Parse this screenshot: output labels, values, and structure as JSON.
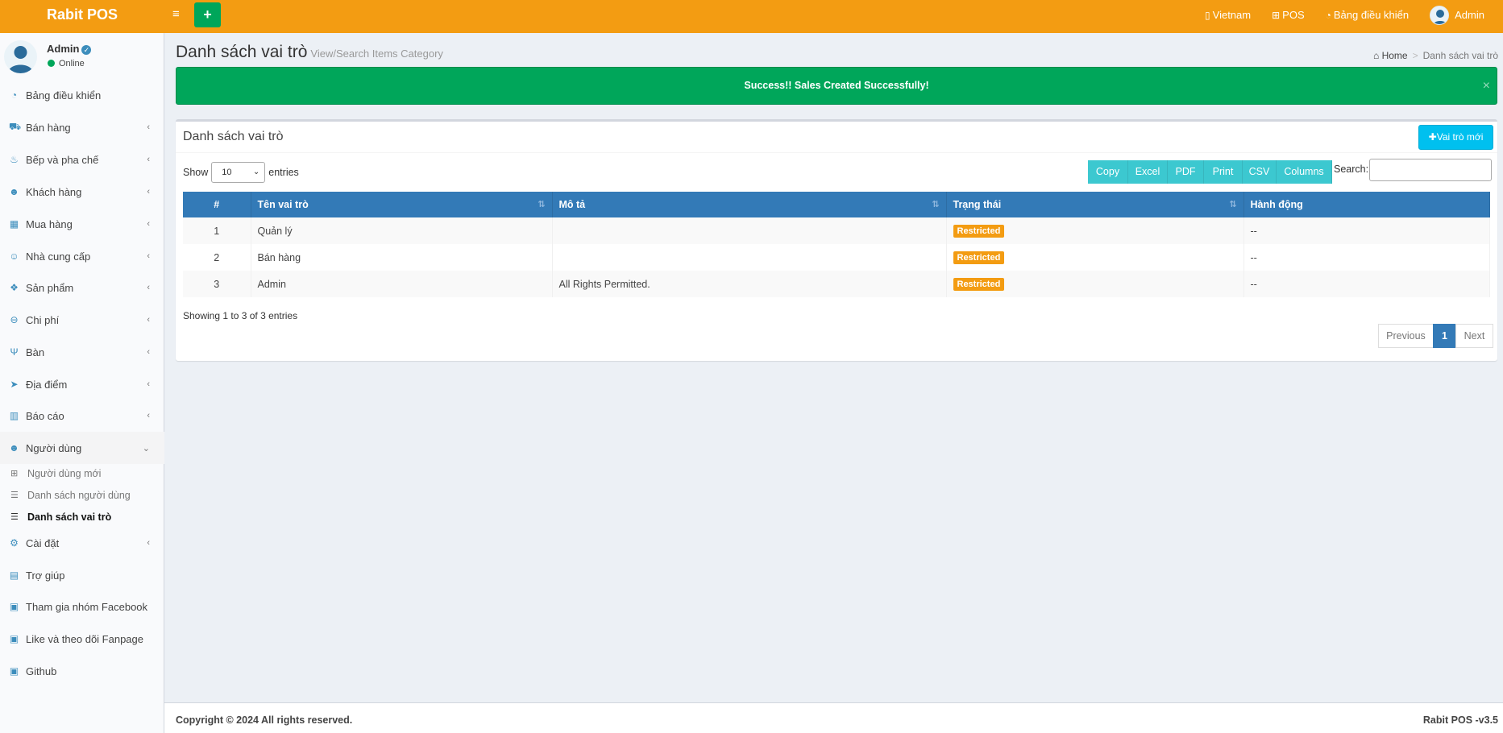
{
  "header": {
    "brand": "Rabit POS",
    "nav": {
      "language": "Vietnam",
      "pos": "POS",
      "dashboard": "Bảng điều khiển",
      "user": "Admin"
    },
    "accent_color": "#f39c12"
  },
  "sidebar": {
    "user": {
      "name": "Admin",
      "status": "Online"
    },
    "items": [
      {
        "label": "Bảng điều khiển",
        "icon": "dashboard-icon",
        "has_children": false
      },
      {
        "label": "Bán hàng",
        "icon": "cart-icon",
        "has_children": true
      },
      {
        "label": "Bếp và pha chế",
        "icon": "kitchen-icon",
        "has_children": true
      },
      {
        "label": "Khách hàng",
        "icon": "users-icon",
        "has_children": true
      },
      {
        "label": "Mua hàng",
        "icon": "grid-icon",
        "has_children": true
      },
      {
        "label": "Nhà cung cấp",
        "icon": "user-plus-icon",
        "has_children": true
      },
      {
        "label": "Sản phẩm",
        "icon": "cubes-icon",
        "has_children": true
      },
      {
        "label": "Chi phí",
        "icon": "minus-circle-icon",
        "has_children": true
      },
      {
        "label": "Bàn",
        "icon": "cutlery-icon",
        "has_children": true
      },
      {
        "label": "Địa điểm",
        "icon": "paper-plane-icon",
        "has_children": true
      },
      {
        "label": "Báo cáo",
        "icon": "bar-chart-icon",
        "has_children": true
      },
      {
        "label": "Người dùng",
        "icon": "users-icon",
        "has_children": true,
        "expanded": true
      }
    ],
    "submenu": [
      {
        "label": "Người dùng mới",
        "icon": "plus-square-icon"
      },
      {
        "label": "Danh sách người dùng",
        "icon": "list-icon"
      },
      {
        "label": "Danh sách vai trò",
        "icon": "list-icon",
        "current": true
      }
    ],
    "items_after": [
      {
        "label": "Cài đặt",
        "icon": "cogs-icon",
        "has_children": true
      },
      {
        "label": "Trợ giúp",
        "icon": "book-icon",
        "has_children": false
      },
      {
        "label": "Tham gia nhóm Facebook",
        "icon": "briefcase-icon",
        "has_children": false
      },
      {
        "label": "Like và theo dõi Fanpage",
        "icon": "briefcase-icon",
        "has_children": false
      },
      {
        "label": "Github",
        "icon": "briefcase-icon",
        "has_children": false
      }
    ]
  },
  "content": {
    "title": "Danh sách vai trò",
    "subtitle": "View/Search Items Category",
    "breadcrumb": {
      "home": "Home",
      "current": "Danh sách vai trò"
    },
    "alert": "Success!! Sales Created Successfully!",
    "alert_close": "×"
  },
  "box": {
    "title": "Danh sách vai trò",
    "new_button": "Vai trò mới",
    "show_label": "Show",
    "entries_label": "entries",
    "page_length": "10",
    "export_buttons": [
      "Copy",
      "Excel",
      "PDF",
      "Print",
      "CSV",
      "Columns"
    ],
    "search_label": "Search:",
    "search_value": "",
    "columns": [
      "#",
      "Tên vai trò",
      "Mô tả",
      "Trạng thái",
      "Hành động"
    ],
    "rows": [
      {
        "num": "1",
        "name": "Quản lý",
        "desc": "",
        "status": "Restricted",
        "action": "--"
      },
      {
        "num": "2",
        "name": "Bán hàng",
        "desc": "",
        "status": "Restricted",
        "action": "--"
      },
      {
        "num": "3",
        "name": "Admin",
        "desc": "All Rights Permitted.",
        "status": "Restricted",
        "action": "--"
      }
    ],
    "info": "Showing 1 to 3 of 3 entries",
    "pagination": {
      "previous": "Previous",
      "page": "1",
      "next": "Next"
    }
  },
  "footer": {
    "copyright": "Copyright © 2024 All rights reserved.",
    "version": "Rabit POS -v3.5"
  }
}
